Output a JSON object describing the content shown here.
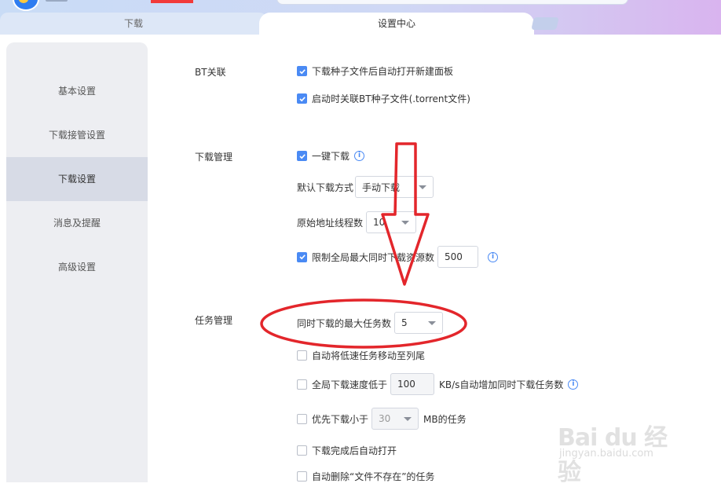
{
  "tabs": {
    "download": "下载",
    "settings": "设置中心"
  },
  "sidebar": {
    "items": [
      {
        "label": "基本设置"
      },
      {
        "label": "下载接管设置"
      },
      {
        "label": "下载设置"
      },
      {
        "label": "消息及提醒"
      },
      {
        "label": "高级设置"
      }
    ],
    "active_index": 2
  },
  "bt": {
    "section_label": "BT关联",
    "auto_open_panel": {
      "label": "下载种子文件后自动打开新建面板",
      "checked": true
    },
    "associate_torrent": {
      "label": "启动时关联BT种子文件(.torrent文件)",
      "checked": true
    }
  },
  "download_mgmt": {
    "section_label": "下载管理",
    "one_click": {
      "label": "一键下载",
      "checked": true
    },
    "default_mode_label": "默认下载方式",
    "default_mode_value": "手动下载",
    "threads_label": "原始地址线程数",
    "threads_value": "10",
    "limit_sources": {
      "label": "限制全局最大同时下载资源数",
      "checked": true,
      "value": "500"
    }
  },
  "task_mgmt": {
    "section_label": "任务管理",
    "max_tasks_label": "同时下载的最大任务数",
    "max_tasks_value": "5",
    "move_slow": {
      "label": "自动将低速任务移动至列尾",
      "checked": false
    },
    "speed_below": {
      "label": "全局下载速度低于",
      "value": "100",
      "suffix": "KB/s自动增加同时下载任务数",
      "checked": false
    },
    "priority_small": {
      "label": "优先下载小于",
      "value": "30",
      "suffix": "MB的任务",
      "checked": false
    },
    "auto_open": {
      "label": "下载完成后自动打开",
      "checked": false
    },
    "auto_delete": {
      "label": "自动删除“文件不存在”的任务",
      "checked": false
    }
  },
  "info_glyph": "i",
  "watermark": {
    "brand": "Bai du 经验",
    "url": "jingyan.baidu.com"
  },
  "colors": {
    "accent": "#4a8af4",
    "annotation_red": "#e3262b",
    "sidebar_bg": "#edeef2",
    "sidebar_active": "#d7dbe6"
  }
}
